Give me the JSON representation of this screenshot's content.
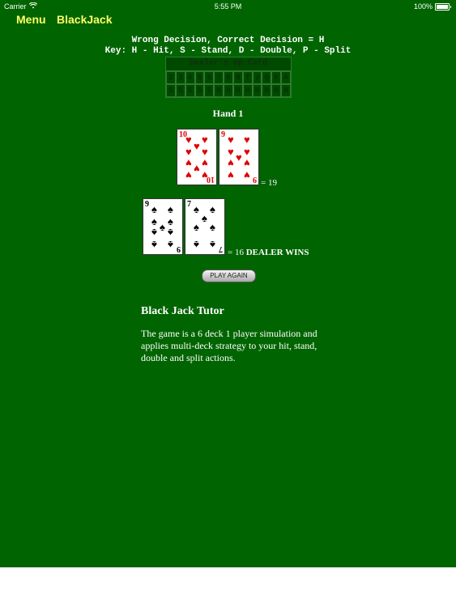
{
  "status_bar": {
    "carrier": "Carrier",
    "time": "5:55 PM",
    "battery": "100%"
  },
  "nav": {
    "menu_label": "Menu",
    "title": "BlackJack"
  },
  "decision": {
    "line1": "Wrong Decision, Correct Decision = H",
    "line2": "Key: H - Hit, S - Stand, D - Double, P - Split"
  },
  "strategy_table": {
    "header": "Dealer's Up Card",
    "cards": [
      "2",
      "3",
      "4",
      "5",
      "6",
      "7",
      "8",
      "9",
      "T",
      "J",
      "Q",
      "K",
      "A"
    ],
    "actions": [
      "S",
      "S",
      "S",
      "S",
      "S",
      "H",
      "H",
      "H",
      "H",
      "H",
      "H",
      "H",
      "H"
    ]
  },
  "hand": {
    "title": "Hand 1"
  },
  "player_cards": [
    {
      "rank": "10",
      "suit": "♥",
      "color": "#e00000"
    },
    {
      "rank": "9",
      "suit": "♥",
      "color": "#e00000"
    }
  ],
  "player_total": "= 19",
  "dealer_cards": [
    {
      "rank": "9",
      "suit": "♠",
      "color": "#000000"
    },
    {
      "rank": "7",
      "suit": "♠",
      "color": "#000000"
    }
  ],
  "dealer_total": "= 16",
  "result": "DEALER WINS",
  "play_again_label": "PLAY AGAIN",
  "tutor": {
    "title": "Black Jack Tutor",
    "description": "The game is a 6 deck 1 player simulation and applies multi-deck strategy to your hit, stand, double and split actions."
  }
}
